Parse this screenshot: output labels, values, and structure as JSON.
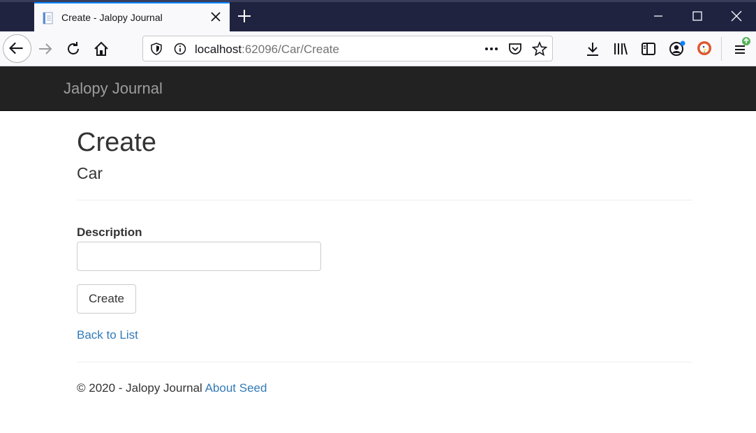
{
  "browser": {
    "tab_title": "Create - Jalopy Journal",
    "url_host": "localhost",
    "url_rest": ":62096/Car/Create",
    "icons": [
      "back-icon",
      "forward-icon",
      "reload-icon",
      "home-icon",
      "shield-icon",
      "info-icon",
      "more-icon",
      "pocket-icon",
      "star-icon",
      "download-icon",
      "library-icon",
      "sidebar-icon",
      "account-icon",
      "duckduckgo-icon",
      "menu-icon",
      "minimize-icon",
      "maximize-icon",
      "close-icon",
      "new-tab-icon"
    ]
  },
  "site": {
    "brand": "Jalopy Journal"
  },
  "page": {
    "title": "Create",
    "subtitle": "Car",
    "form": {
      "description_label": "Description",
      "description_value": "",
      "submit_label": "Create"
    },
    "back_link": "Back to List"
  },
  "footer": {
    "copyright": "© 2020 - Jalopy Journal",
    "about_link": "About Seed"
  },
  "colors": {
    "navbar_bg": "#222222",
    "brand": "#9d9d9d",
    "link": "#337ab7",
    "tabbar_bg": "#202340",
    "tab_accent": "#0a84ff"
  }
}
